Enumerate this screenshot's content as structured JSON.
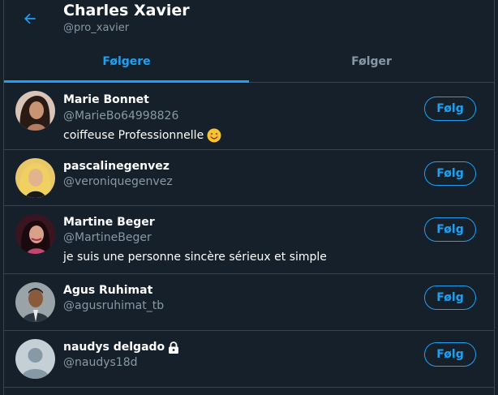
{
  "header": {
    "title": "Charles Xavier",
    "handle": "@pro_xavier"
  },
  "tabs": [
    {
      "label": "Følgere",
      "active": true
    },
    {
      "label": "Følger",
      "active": false
    }
  ],
  "accent_color": "#1da1f2",
  "users": [
    {
      "name": "Marie Bonnet",
      "handle": "@MarieBo64998826",
      "bio": "coiffeuse Professionnelle",
      "bio_emoji": "smiling-face-icon",
      "button": "Følg"
    },
    {
      "name": "pascalinegenvez",
      "handle": "@veroniquegenvez",
      "bio": "",
      "button": "Følg"
    },
    {
      "name": "Martine Beger",
      "handle": "@MartineBeger",
      "bio": "je suis une personne sincère sérieux et simple",
      "button": "Følg"
    },
    {
      "name": "Agus Ruhimat",
      "handle": "@agusruhimat_tb",
      "bio": "",
      "button": "Følg"
    },
    {
      "name": "naudys delgado",
      "handle": "@naudys18d",
      "bio": "",
      "locked": true,
      "button": "Følg"
    }
  ]
}
